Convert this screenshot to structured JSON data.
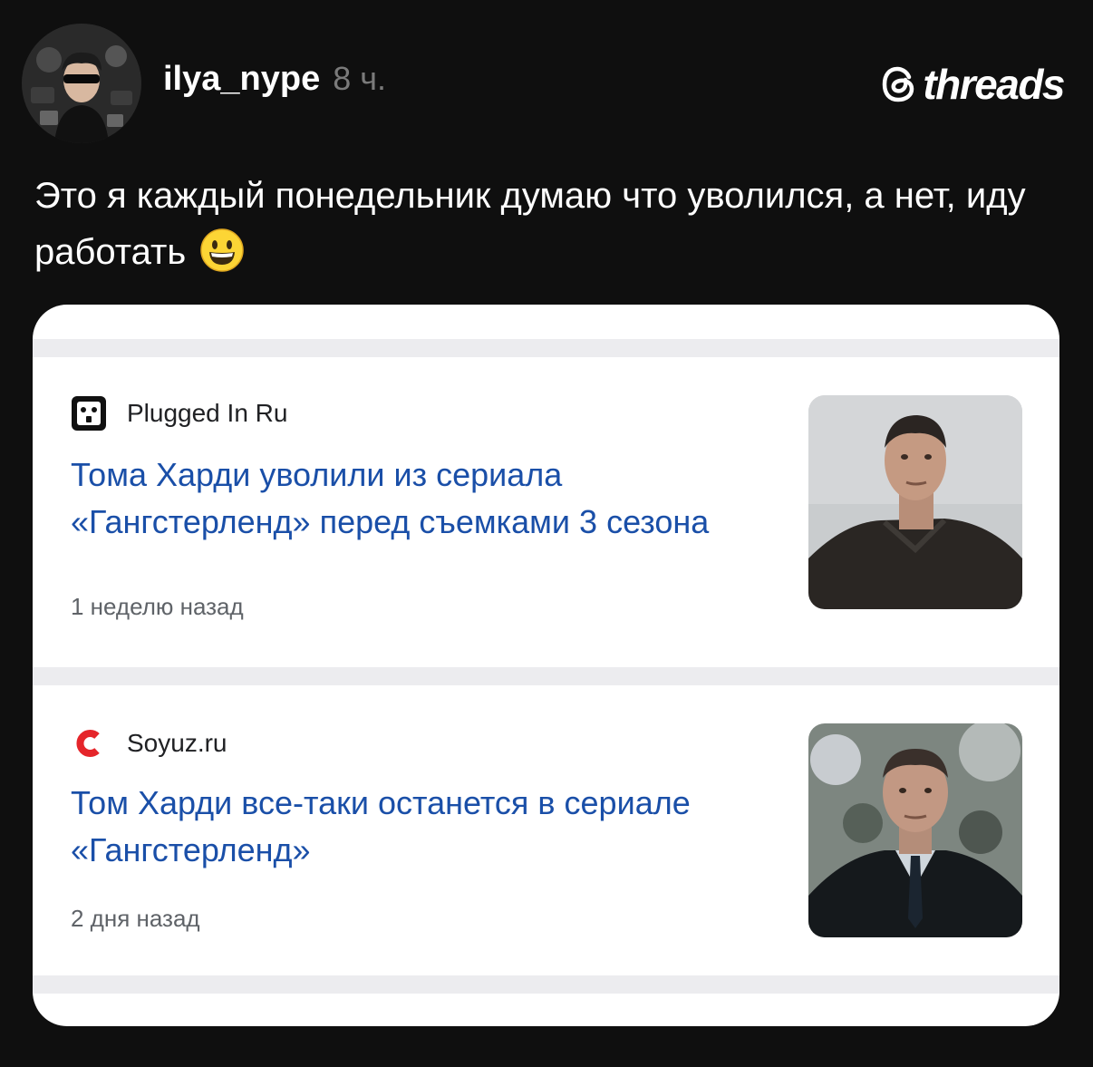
{
  "post": {
    "username": "ilya_nype",
    "time": "8 ч.",
    "brand": "threads",
    "text": "Это я каждый понедельник думаю что уволился, а нет, иду работать",
    "emoji": "grinning-face-emoji"
  },
  "card": {
    "items": [
      {
        "source": "Plugged In Ru",
        "headline": "Тома Харди уволили из сериала «Гангстерленд» перед съемками 3 сезона",
        "ago": "1 неделю назад",
        "source_icon": "plugged-in-logo-icon"
      },
      {
        "source": "Soyuz.ru",
        "headline": "Том Харди все-таки останется в сериале «Гангстерленд»",
        "ago": "2 дня назад",
        "source_icon": "soyuz-logo-icon"
      }
    ]
  },
  "colors": {
    "background": "#0f0f0f",
    "headline": "#1a4fa8",
    "time": "#7a7a7a",
    "soyuz_red": "#e5252a"
  }
}
